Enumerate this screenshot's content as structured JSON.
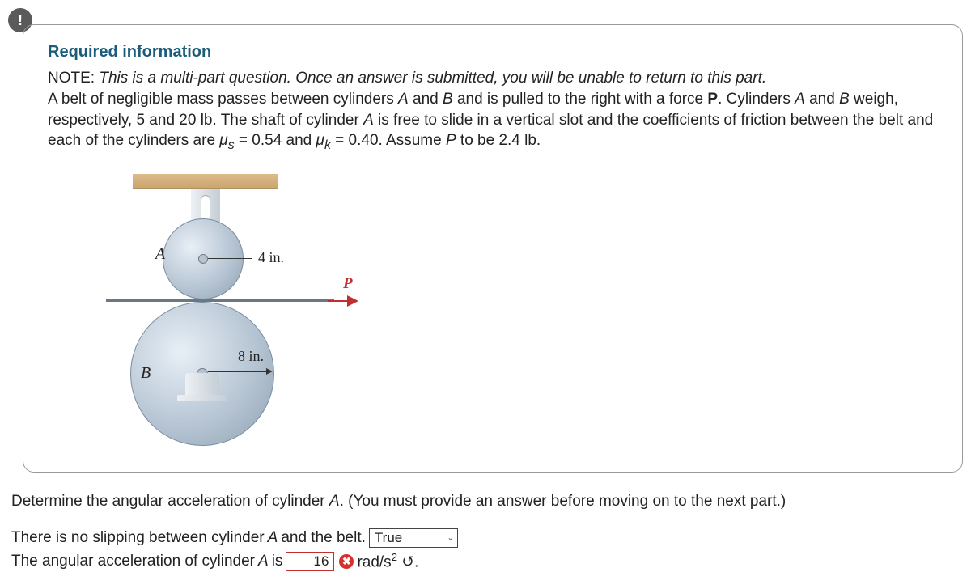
{
  "alert_symbol": "!",
  "required_info_heading": "Required information",
  "note_prefix": "NOTE: ",
  "note_italic": "This is a multi-part question. Once an answer is submitted, you will be unable to return to this part.",
  "problem_line1_a": "A belt of negligible mass passes between cylinders ",
  "cyl_a": "A",
  "problem_line1_b": " and ",
  "cyl_b": "B",
  "problem_line1_c": " and is pulled to the right with a force ",
  "force_p": "P",
  "problem_line1_d": ". Cylinders ",
  "problem_line1_e": " and ",
  "problem_line1_f": " weigh, respectively, 5 and 20 lb. The shaft of cylinder ",
  "problem_line1_g": " is free to slide in a vertical slot and the coefficients of friction between the belt and each of the cylinders are ",
  "mu_s_label": "μ",
  "mu_s_sub": "s",
  "mu_s_eq": " = 0.54 and ",
  "mu_k_label": "μ",
  "mu_k_sub": "k",
  "mu_k_eq": " = 0.40. Assume ",
  "problem_line1_h": " to be 2.4 lb.",
  "diagram": {
    "label_a": "A",
    "label_b": "B",
    "label_p": "P",
    "dim_a": "4 in.",
    "dim_b": "8 in."
  },
  "question_instruction_a": "Determine the angular acceleration of cylinder ",
  "question_instruction_b": ". (You must provide an answer before moving on to the next part.)",
  "slip_row_a": "There is no slipping between cylinder ",
  "slip_row_b": " and the belt.",
  "select_value": "True",
  "accel_row_a": "The angular acceleration of cylinder ",
  "accel_row_b": " is",
  "input_value": "16",
  "x_badge": "✖",
  "unit_a": " rad/s",
  "unit_sup": "2",
  "unit_b": " ↺."
}
